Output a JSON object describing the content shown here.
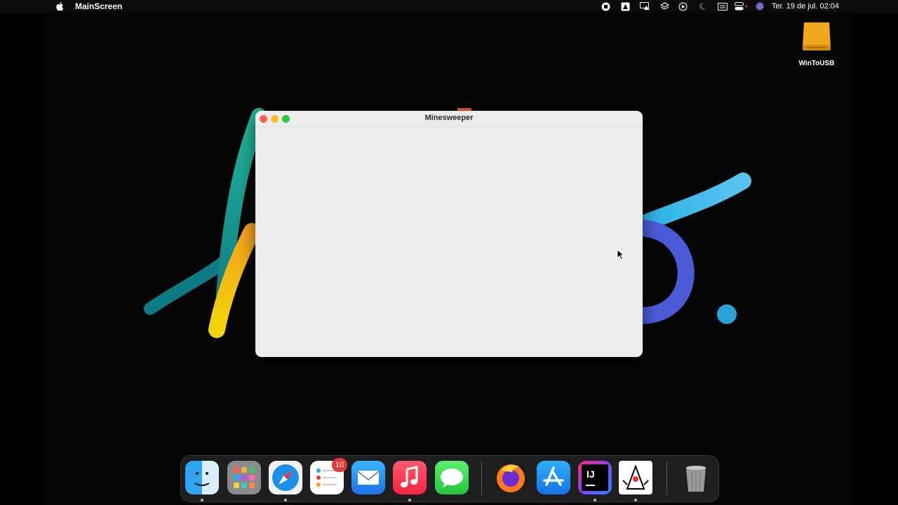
{
  "menubar": {
    "app_name": "MainScreen",
    "datetime": "Ter. 19 de jul.  02:04",
    "status_icons": [
      "stop-icon",
      "airdrop-icon",
      "display-icon",
      "layers-icon",
      "play-circle-icon",
      "moon-icon",
      "keyboard-icon",
      "control-center-icon",
      "siri-icon"
    ]
  },
  "desktop": {
    "drive_label": "WinToUSB"
  },
  "window": {
    "title": "Minesweeper"
  },
  "dock": {
    "reminders_badge": "10",
    "items": [
      "finder",
      "launchpad",
      "safari",
      "reminders",
      "mail",
      "music",
      "messages",
      "firefox",
      "app-store",
      "intellij-idea",
      "java-launcher",
      "trash"
    ]
  },
  "colors": {
    "close": "#ff5f57",
    "minimize": "#febc2e",
    "zoom": "#28c840",
    "badge": "#e53935"
  }
}
